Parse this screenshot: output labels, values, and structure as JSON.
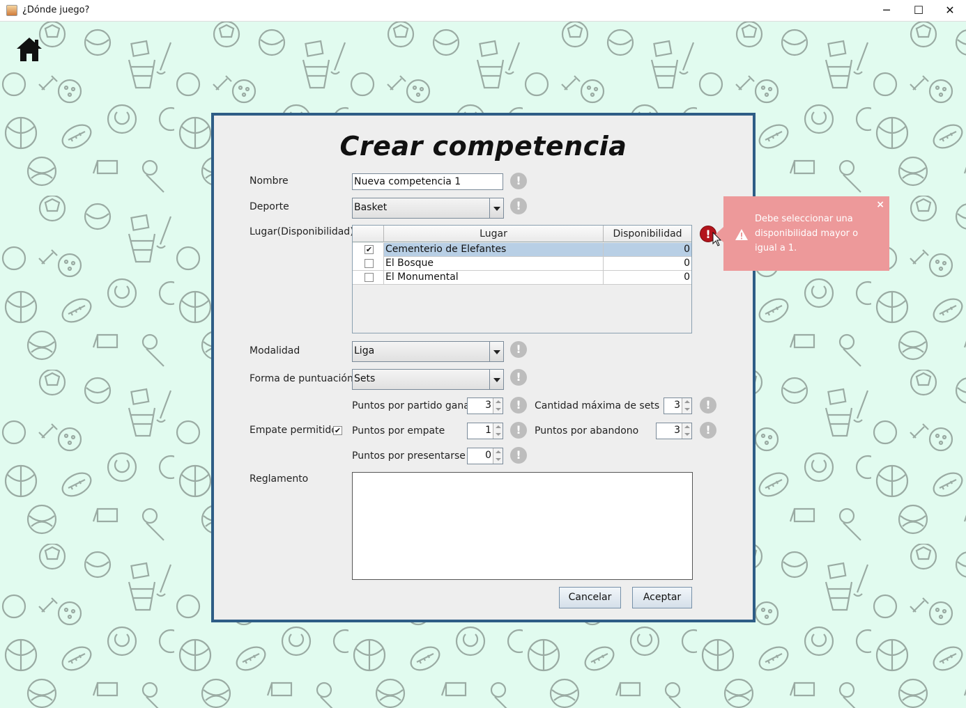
{
  "window": {
    "title": "¿Dónde juego?",
    "minimize": "─",
    "maximize": "☐",
    "close": "✕"
  },
  "dialog": {
    "title": "Crear competencia",
    "fields": {
      "nombre_label": "Nombre",
      "nombre_value": "Nueva competencia 1",
      "deporte_label": "Deporte",
      "deporte_value": "Basket",
      "lugar_label": "Lugar(Disponibilidad)",
      "modalidad_label": "Modalidad",
      "modalidad_value": "Liga",
      "puntuacion_label": "Forma de puntuación",
      "puntuacion_value": "Sets",
      "puntos_ganado_label": "Puntos por partido ganado",
      "puntos_ganado_value": "3",
      "cantidad_sets_label": "Cantidad máxima de sets",
      "cantidad_sets_value": "3",
      "empate_label": "Empate permitido",
      "empate_checked": "✔",
      "puntos_empate_label": "Puntos por empate",
      "puntos_empate_value": "1",
      "puntos_abandono_label": "Puntos por abandono",
      "puntos_abandono_value": "3",
      "puntos_presentarse_label": "Puntos por presentarse",
      "puntos_presentarse_value": "0",
      "reglamento_label": "Reglamento"
    },
    "info_glyph": "!",
    "table": {
      "headers": [
        "",
        "Lugar",
        "Disponibilidad"
      ],
      "rows": [
        {
          "checked": "✔",
          "lugar": "Cementerio de Elefantes",
          "disponibilidad": "0"
        },
        {
          "checked": "",
          "lugar": "El Bosque",
          "disponibilidad": "0"
        },
        {
          "checked": "",
          "lugar": "El Monumental",
          "disponibilidad": "0"
        }
      ]
    },
    "buttons": {
      "cancel": "Cancelar",
      "accept": "Aceptar"
    }
  },
  "error": {
    "glyph": "!",
    "message": "Debe seleccionar una disponibilidad mayor o igual a 1.",
    "close": "×"
  },
  "colors": {
    "background": "#e1fbef",
    "panel_border": "#2e5d86",
    "toast": "#ed999a",
    "error_icon": "#b3141c"
  },
  "icons": [
    "home-icon",
    "warning-icon",
    "info-icon",
    "error-icon",
    "close-icon"
  ]
}
